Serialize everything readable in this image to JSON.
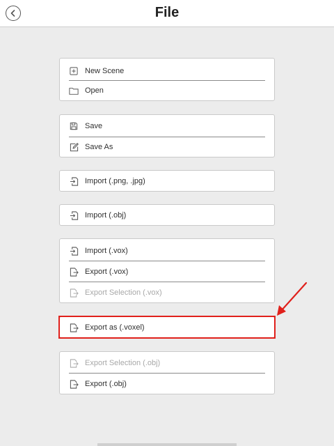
{
  "header": {
    "title": "File",
    "back_icon": "chevron-left-circle-icon"
  },
  "menu": {
    "new_scene": "New Scene",
    "open": "Open",
    "save": "Save",
    "save_as": "Save As",
    "import_png_jpg": "Import (.png, .jpg)",
    "import_obj": "Import (.obj)",
    "import_vox": "Import (.vox)",
    "export_vox": "Export (.vox)",
    "export_selection_vox": "Export Selection (.vox)",
    "export_voxel": "Export as (.voxel)",
    "export_selection_obj": "Export Selection (.obj)",
    "export_obj": "Export (.obj)"
  },
  "colors": {
    "highlight": "#e0201b",
    "background": "#ececec",
    "disabled_text": "#a8a8a8"
  }
}
